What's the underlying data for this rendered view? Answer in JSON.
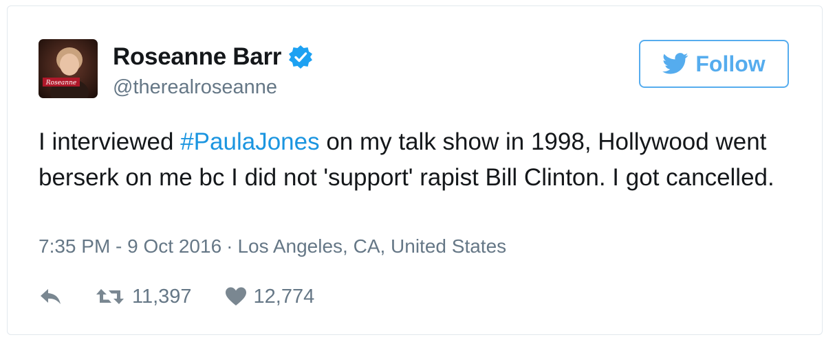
{
  "user": {
    "name": "Roseanne Barr",
    "handle": "@therealroseanne",
    "avatar_caption": "Roseanne"
  },
  "follow_button": {
    "label": "Follow"
  },
  "tweet": {
    "text_before": "I interviewed ",
    "hashtag": "#PaulaJones",
    "text_after": " on my talk show in 1998, Hollywood went berserk on me bc I did not 'support' rapist Bill Clinton. I got cancelled."
  },
  "meta": {
    "time": "7:35 PM - 9 Oct 2016",
    "separator": "·",
    "location": "Los Angeles, CA, United States"
  },
  "stats": {
    "retweets": "11,397",
    "likes": "12,774"
  },
  "colors": {
    "link": "#1b95e0",
    "twitter_blue": "#55acee",
    "muted": "#657786",
    "text": "#14171a"
  },
  "icons": [
    "verified-badge-icon",
    "twitter-bird-icon",
    "reply-icon",
    "retweet-icon",
    "heart-icon"
  ]
}
